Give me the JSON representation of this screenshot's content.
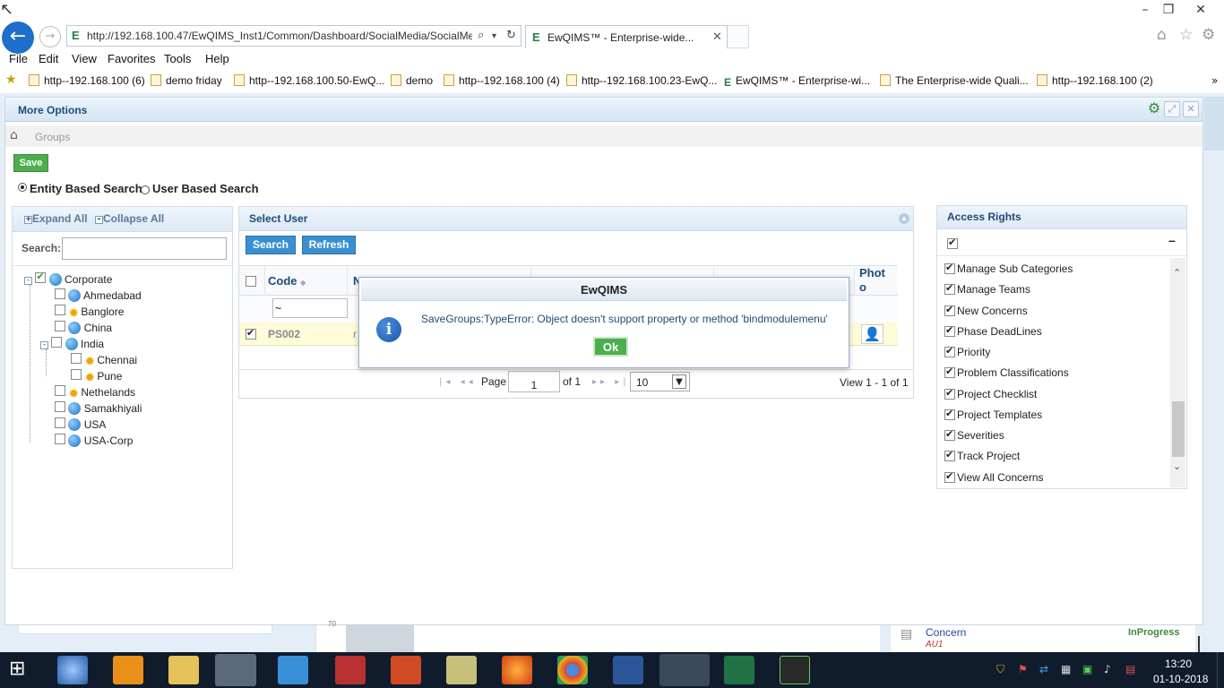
{
  "browser": {
    "url": "http://192.168.100.47/EwQIMS_Inst1/Common/Dashboard/SocialMedia/SocialMe",
    "tab_title": "EwQIMS™ - Enterprise-wide...",
    "menu": [
      "File",
      "Edit",
      "View",
      "Favorites",
      "Tools",
      "Help"
    ],
    "favorites": [
      "http--192.168.100 (6)",
      "demo friday",
      "http--192.168.100.50-EwQ...",
      "demo",
      "http--192.168.100 (4)",
      "http--192.168.100.23-EwQ...",
      "EwQIMS™ - Enterprise-wi...",
      "The Enterprise-wide Quali...",
      "http--192.168.100 (2)"
    ]
  },
  "page": {
    "title": "More Options",
    "breadcrumb": "Groups",
    "save_label": "Save",
    "search_modes": [
      "Entity Based Search",
      "User Based Search"
    ]
  },
  "tree": {
    "expand_all": "Expand All",
    "collapse_all": "Collapse All",
    "search_label": "Search:",
    "nodes": [
      {
        "label": "Corporate",
        "icon": "globe-icon",
        "checked": true
      },
      {
        "label": "Ahmedabad",
        "icon": "globe-icon"
      },
      {
        "label": "Banglore",
        "icon": "gear-icon"
      },
      {
        "label": "China",
        "icon": "globe-icon"
      },
      {
        "label": "India",
        "icon": "globe-icon"
      },
      {
        "label": "Chennai",
        "icon": "gear-icon"
      },
      {
        "label": "Pune",
        "icon": "gear-icon"
      },
      {
        "label": "Nethelands",
        "icon": "gear-icon"
      },
      {
        "label": "Samakhiyali",
        "icon": "globe-icon"
      },
      {
        "label": "USA",
        "icon": "globe-icon"
      },
      {
        "label": "USA-Corp",
        "icon": "globe-icon"
      }
    ]
  },
  "users": {
    "title": "Select User",
    "search_label": "Search",
    "refresh_label": "Refresh",
    "col_code": "Code",
    "col_name_partial": "N",
    "col_photo_1": "Phot",
    "col_photo_2": "o",
    "filter_symbol": "~",
    "row_code": "PS002",
    "row_name_partial": "r",
    "pager": {
      "page_label": "Page",
      "page": "1",
      "of": "of 1",
      "size": "10",
      "view": "View 1 - 1 of 1"
    }
  },
  "access_rights": {
    "title": "Access Rights",
    "collapse_symbol": "–",
    "items": [
      "Manage Sub Categories",
      "Manage Teams",
      "New Concerns",
      "Phase DeadLines",
      "Priority",
      "Problem Classifications",
      "Project Checklist",
      "Project Templates",
      "Severities",
      "Track Project",
      "View All Concerns"
    ]
  },
  "dialog": {
    "title": "EwQIMS",
    "message": "SaveGroups:TypeError: Object doesn't support property or method 'bindmodulemenu'",
    "ok_label": "Ok"
  },
  "background": {
    "concern_label": "Concern",
    "concern_sub": "AU1",
    "status": "InProgress",
    "line_number": "70"
  },
  "taskbar": {
    "time": "13:20",
    "date": "01-10-2018"
  },
  "colors": {
    "accent_blue": "#1e6fcb",
    "save_green": "#4cae4c",
    "header_text": "#1f4a78",
    "taskbar": "#101c2c"
  }
}
